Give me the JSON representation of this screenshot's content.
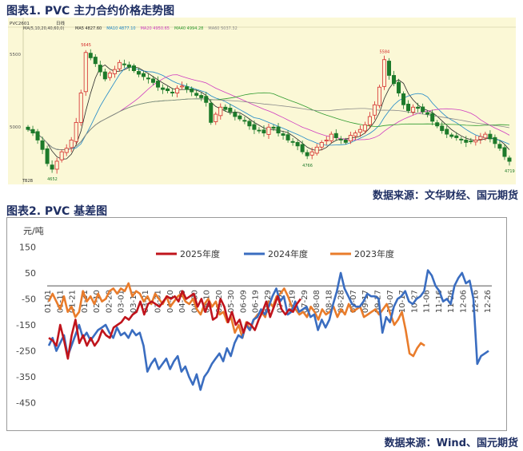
{
  "figure1": {
    "title": "图表1. PVC 主力合约价格走势图",
    "source": "数据来源：文华财经、国元期货",
    "header": {
      "contract": "PVC2601",
      "label": "日线",
      "ma_params": "MA(5,10,20,40,60,0)",
      "ma_values": [
        {
          "label": "MA5 4827.60",
          "color": "#2a2a2a"
        },
        {
          "label": "MA10 4877.10",
          "color": "#1e88c8"
        },
        {
          "label": "MA20 4950.65",
          "color": "#cf3bc0"
        },
        {
          "label": "MA40 4994.28",
          "color": "#2e9a2e"
        },
        {
          "label": "MA60 5037.32",
          "color": "#8a8a8a"
        }
      ]
    },
    "y_tick_labels": [
      "5500",
      "5000"
    ],
    "annotations": [
      "5645",
      "5584",
      "4766",
      "4719",
      "4652"
    ],
    "corner_label": "TB2B",
    "colors": {
      "background": "#fbf8d6",
      "up": "#d42a2a",
      "down": "#1d7a2a"
    }
  },
  "figure2": {
    "title": "图表2. PVC 基差图",
    "source": "数据来源：Wind、国元期货",
    "unit": "元/吨"
  },
  "chart_data": [
    {
      "type": "candlestick",
      "title": "PVC 主力合约价格走势图",
      "y_ticks": [
        5500,
        5000
      ],
      "ylim": [
        4550,
        5820
      ],
      "annotations": [
        {
          "label": "5645",
          "value": 5645
        },
        {
          "label": "5584",
          "value": 5584
        },
        {
          "label": "4766",
          "value": 4766
        },
        {
          "label": "4719",
          "value": 4719
        },
        {
          "label": "4652",
          "value": 4652
        }
      ],
      "close_path": [
        4990,
        4960,
        4900,
        4820,
        4700,
        4652,
        4720,
        4800,
        4830,
        4900,
        5050,
        5300,
        5645,
        5600,
        5550,
        5480,
        5420,
        5470,
        5500,
        5560,
        5540,
        5520,
        5490,
        5460,
        5440,
        5420,
        5390,
        5350,
        5330,
        5320,
        5300,
        5340,
        5360,
        5330,
        5310,
        5280,
        5260,
        5220,
        5050,
        5120,
        5180,
        5160,
        5140,
        5100,
        5080,
        5060,
        5020,
        4990,
        4980,
        4960,
        5010,
        5000,
        4960,
        4940,
        4900,
        4880,
        4850,
        4800,
        4766,
        4800,
        4840,
        4880,
        4900,
        4950,
        4920,
        4900,
        4880,
        4940,
        4960,
        4990,
        5030,
        5100,
        5200,
        5350,
        5584,
        5450,
        5380,
        5300,
        5200,
        5150,
        5180,
        5170,
        5140,
        5120,
        5060,
        5020,
        4980,
        4950,
        4930,
        4920,
        4900,
        4880,
        4890,
        4900,
        4930,
        4950,
        4910,
        4870,
        4830,
        4760,
        4719
      ],
      "moving_averages": [
        {
          "name": "MA5",
          "value": 4827.6,
          "color": "#2a2a2a"
        },
        {
          "name": "MA10",
          "value": 4877.1,
          "color": "#1e88c8"
        },
        {
          "name": "MA20",
          "value": 4950.65,
          "color": "#cf3bc0"
        },
        {
          "name": "MA40",
          "value": 4994.28,
          "color": "#2e9a2e"
        },
        {
          "name": "MA60",
          "value": 5037.32,
          "color": "#8a8a8a"
        }
      ]
    },
    {
      "type": "line",
      "title": "PVC 基差图",
      "ylabel": "元/吨",
      "ylim": [
        -500,
        200
      ],
      "yticks": [
        150,
        50,
        -50,
        -150,
        -250,
        -350,
        -450
      ],
      "grid": false,
      "legend_position": "top-center",
      "x_tick_labels": [
        "01-01",
        "01-11",
        "01-21",
        "01-31",
        "02-10",
        "02-20",
        "03-01",
        "03-11",
        "03-21",
        "03-31",
        "04-10",
        "04-20",
        "04-30",
        "05-10",
        "05-20",
        "05-30",
        "06-09",
        "06-19",
        "06-29",
        "07-09",
        "07-19",
        "07-29",
        "08-08",
        "08-18",
        "08-28",
        "09-07",
        "09-17",
        "09-27",
        "10-07",
        "10-17",
        "10-27",
        "11-06",
        "11-16",
        "11-26",
        "12-06",
        "12-16",
        "12-26"
      ],
      "series": [
        {
          "name": "2025年度",
          "color": "#c0141c",
          "values": [
            -200,
            -210,
            -230,
            -150,
            -210,
            -280,
            -190,
            -130,
            -220,
            -190,
            -230,
            -200,
            -230,
            -210,
            -170,
            -190,
            -200,
            -160,
            -150,
            -140,
            -120,
            -130,
            -110,
            -100,
            -60,
            -110,
            -70,
            -60,
            -70,
            -80,
            -60,
            -40,
            -50,
            -40,
            -60,
            -20,
            -50,
            -40,
            -30,
            -80,
            -50,
            -100,
            -60,
            -130,
            -120,
            -50,
            -80,
            -140,
            -100,
            -150,
            -130,
            -180,
            -140,
            -150,
            -170,
            -130,
            -100,
            -60,
            -120,
            -80,
            -40,
            -90,
            -110,
            -90,
            -100,
            -70,
            -50
          ]
        },
        {
          "name": "2024年度",
          "color": "#3a6dc0",
          "values": [
            -230,
            -200,
            -250,
            -220,
            -190,
            -270,
            -230,
            -190,
            -150,
            -200,
            -180,
            -210,
            -190,
            -170,
            -160,
            -150,
            -180,
            -200,
            -160,
            -190,
            -180,
            -200,
            -170,
            -190,
            -180,
            -230,
            -330,
            -300,
            -280,
            -320,
            -300,
            -280,
            -320,
            -290,
            -270,
            -330,
            -310,
            -350,
            -380,
            -340,
            -400,
            -350,
            -330,
            -300,
            -280,
            -260,
            -290,
            -240,
            -270,
            -220,
            -190,
            -200,
            -150,
            -170,
            -130,
            -120,
            -90,
            -110,
            -80,
            -40,
            -10,
            -60,
            -40,
            -110,
            -100,
            -60,
            -100,
            -90,
            -80,
            -120,
            -110,
            -170,
            -130,
            -160,
            -130,
            -70,
            -20,
            50,
            -10,
            -40,
            -70,
            -80,
            -80,
            -60,
            -30,
            -40,
            -40,
            -50,
            -180,
            -120,
            -140,
            -80,
            -50,
            -40,
            -20,
            -60,
            -70,
            -50,
            -40,
            -20,
            60,
            40,
            0,
            -20,
            -60,
            -50,
            -70,
            0,
            30,
            50,
            10,
            20,
            -50,
            -300,
            -270,
            -260,
            -250
          ]
        },
        {
          "name": "2023年度",
          "color": "#e97c2b",
          "values": [
            -60,
            -30,
            -60,
            -90,
            -40,
            -100,
            -80,
            -120,
            -100,
            -20,
            -60,
            -40,
            -70,
            -30,
            -60,
            -50,
            -20,
            -10,
            -30,
            -10,
            -20,
            10,
            -40,
            -20,
            -30,
            -60,
            -40,
            -70,
            -30,
            -50,
            -70,
            -40,
            -80,
            -60,
            -40,
            -30,
            -60,
            -70,
            -50,
            -90,
            -110,
            -70,
            -50,
            -80,
            -60,
            -110,
            -100,
            -140,
            -120,
            -180,
            -150,
            -200,
            -140,
            -170,
            -130,
            -110,
            -100,
            -120,
            -60,
            -80,
            -40,
            -30,
            -10,
            -40,
            -80,
            -90,
            -110,
            -100,
            -120,
            -80,
            -100,
            -130,
            -90,
            -110,
            -100,
            -80,
            -120,
            -90,
            -110,
            -70,
            -100,
            -90,
            -80,
            -120,
            -110,
            -100,
            -90,
            -110,
            -90,
            -70,
            -110,
            -150,
            -130,
            -100,
            -170,
            -260,
            -270,
            -240,
            -220,
            -230
          ]
        }
      ]
    }
  ]
}
